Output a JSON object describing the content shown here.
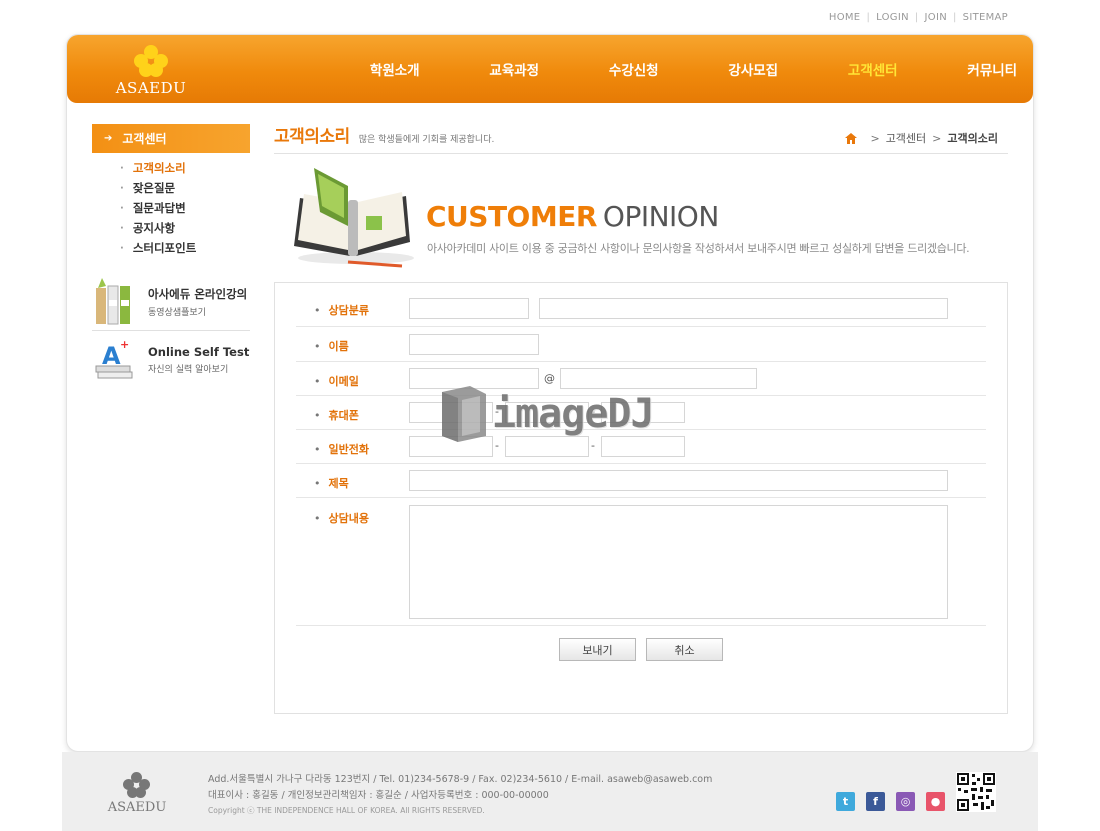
{
  "util_links": [
    "HOME",
    "LOGIN",
    "JOIN",
    "SITEMAP"
  ],
  "logo": {
    "text": "ASAEDU"
  },
  "nav": [
    {
      "label": "학원소개"
    },
    {
      "label": "교육과정"
    },
    {
      "label": "수강신청"
    },
    {
      "label": "강사모집"
    },
    {
      "label": "고객센터",
      "active": true
    },
    {
      "label": "커뮤니티"
    }
  ],
  "sidebar": {
    "title": "고객센터",
    "items": [
      {
        "label": "고객의소리",
        "active": true
      },
      {
        "label": "잦은질문"
      },
      {
        "label": "질문과답변"
      },
      {
        "label": "공지사항"
      },
      {
        "label": "스터디포인트"
      }
    ],
    "banners": [
      {
        "title": "아사에듀 온라인강의",
        "sub": "동영상샘플보기"
      },
      {
        "title": "Online Self Test",
        "sub": "자신의 실력 알아보기"
      }
    ]
  },
  "content": {
    "title": "고객의소리",
    "subtitle": "많은 학생들에게 기회를 제공합니다.",
    "breadcrumb": [
      "고객센터",
      "고객의소리"
    ],
    "hero_heading_accent": "CUSTOMER",
    "hero_heading_rest": "OPINION",
    "hero_desc": "아사아카데미 사이트 이용 중 궁금하신 사항이나 문의사항을 작성하셔서 보내주시면 빠르고 성실하게 답변을 드리겠습니다."
  },
  "form": {
    "category_label": "상담분류",
    "name_label": "이름",
    "email_label": "이메일",
    "email_at": "@",
    "mobile_label": "휴대폰",
    "phone_label": "일반전화",
    "phone_sep": "-",
    "subject_label": "제목",
    "message_label": "상담내용",
    "submit_label": "보내기",
    "cancel_label": "취소"
  },
  "watermark": {
    "text": "imageDJ"
  },
  "footer": {
    "logo_text": "ASAEDU",
    "line1": "Add.서울특별시 가나구 다라동 123번지  / Tel. 01)234-5678-9  / Fax. 02)234-5610  / E-mail. asaweb@asaweb.com",
    "line2": "대표이사 : 홍길동 / 개인정보관리책임자 : 홍길순 / 사업자등록번호 : 000-00-00000",
    "copyright": "Copyright ⓒ THE INDEPENDENCE HALL OF KOREA. All RIGHTS RESERVED."
  },
  "colors": {
    "brand": "#f08a0c",
    "accent_text": "#e9780a",
    "nav_active": "#ffe536"
  },
  "icons": [
    "home-icon",
    "twitter-icon",
    "facebook-icon",
    "instagram-icon",
    "blog-icon",
    "qr-code-icon"
  ]
}
